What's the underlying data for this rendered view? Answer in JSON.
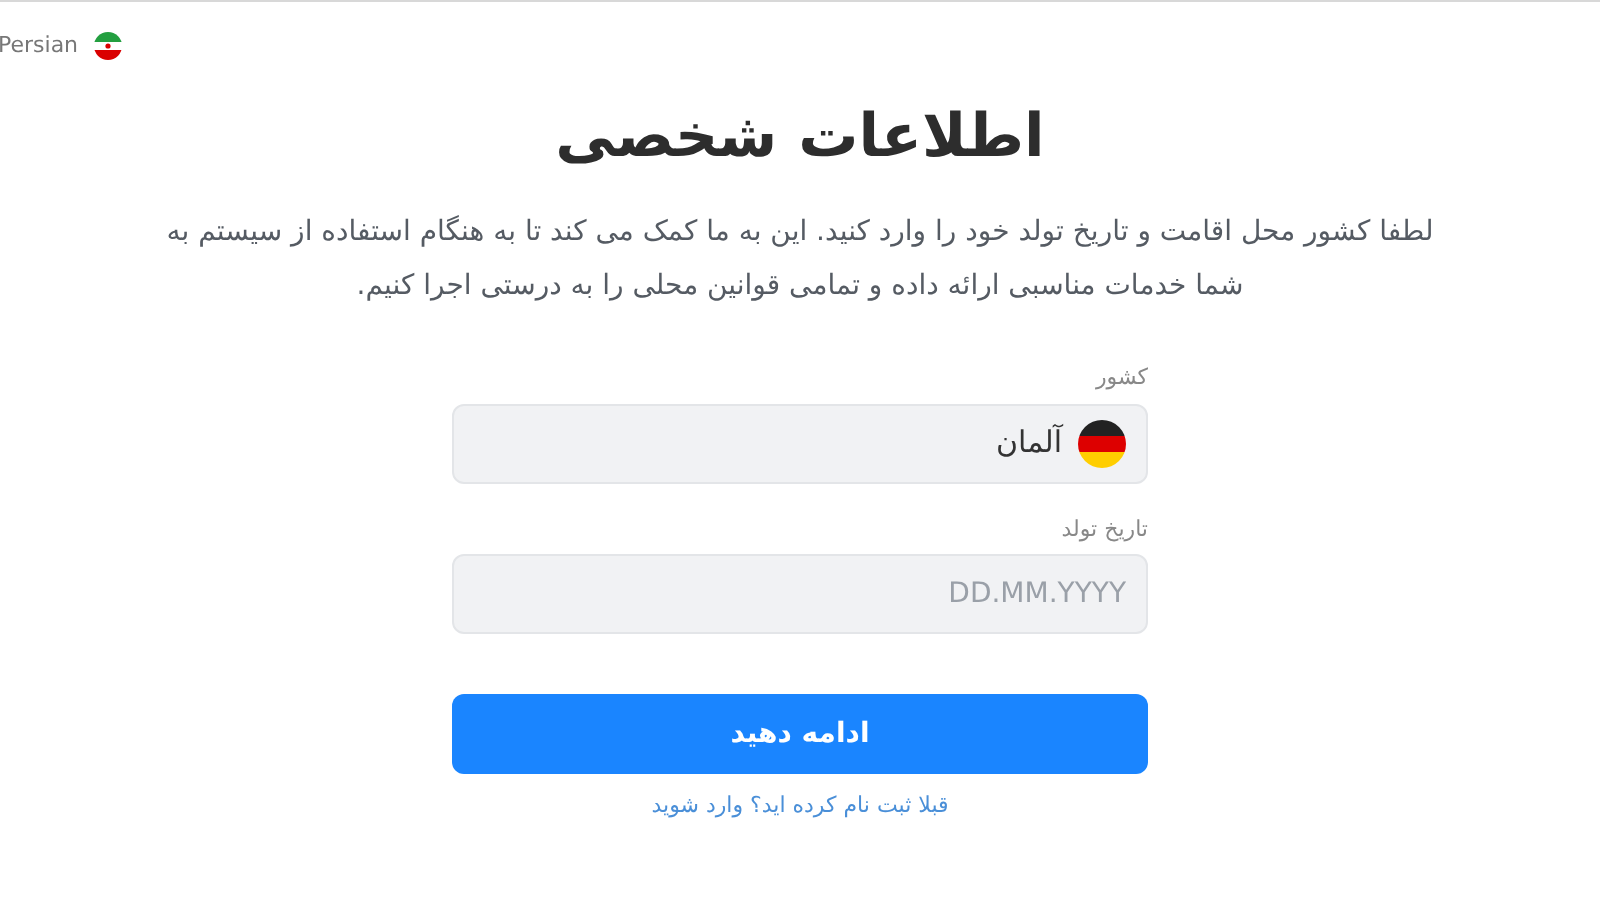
{
  "language": {
    "label": "Persian"
  },
  "title": "اطلاعات شخصی",
  "description": "لطفا کشور محل اقامت و تاریخ تولد خود را وارد کنید. این به ما کمک می کند تا به هنگام استفاده از سیستم به شما خدمات مناسبی ارائه داده و تمامی قوانین محلی را به درستی اجرا کنیم.",
  "country": {
    "label": "کشور",
    "value": "آلمان"
  },
  "birth_date": {
    "label": "تاریخ تولد",
    "placeholder": "DD.MM.YYYY"
  },
  "continue_button": "ادامه دهید",
  "login_link": "قبلا ثبت نام کرده اید؟ وارد شوید"
}
